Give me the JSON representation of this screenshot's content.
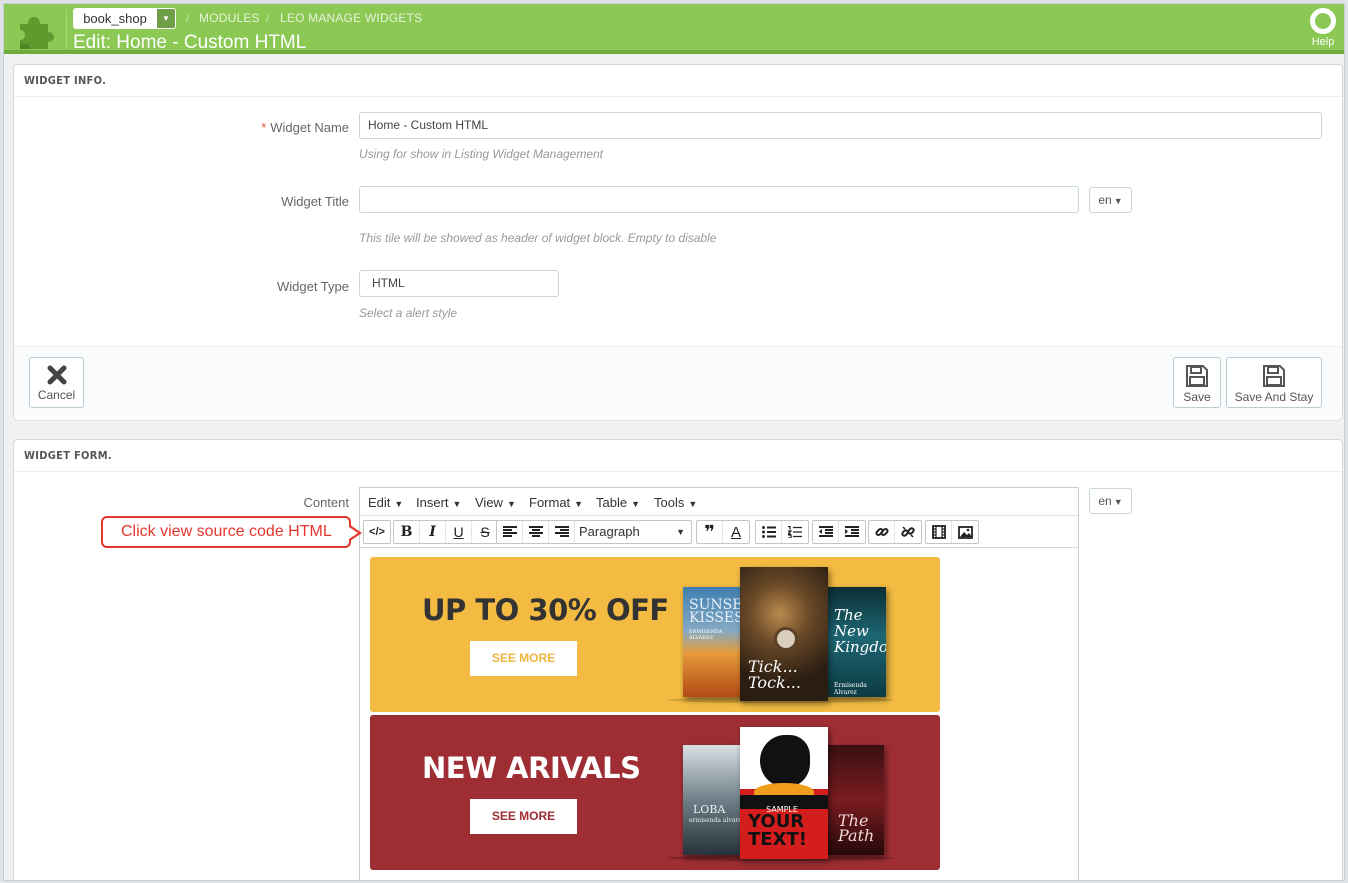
{
  "header": {
    "shop": "book_shop",
    "breadcrumb": [
      "MODULES",
      "LEO MANAGE WIDGETS"
    ],
    "title": "Edit: Home - Custom HTML",
    "help_label": "Help"
  },
  "widget_info": {
    "heading": "WIDGET INFO.",
    "name_label": "Widget Name",
    "name_value": "Home - Custom HTML",
    "name_hint": "Using for show in Listing Widget Management",
    "title_label": "Widget Title",
    "title_value": "",
    "title_lang": "en",
    "title_hint": "This tile will be showed as header of widget block. Empty to disable",
    "type_label": "Widget Type",
    "type_value": "HTML",
    "type_hint": "Select a alert style",
    "cancel_label": "Cancel",
    "save_label": "Save",
    "save_stay_label": "Save And Stay"
  },
  "widget_form": {
    "heading": "WIDGET FORM.",
    "content_label": "Content",
    "lang": "en",
    "menu": [
      "Edit",
      "Insert",
      "View",
      "Format",
      "Table",
      "Tools"
    ],
    "format_select": "Paragraph",
    "banners": [
      {
        "title": "UP TO 30% OFF",
        "button": "SEE MORE",
        "bg": "#f3bb42",
        "btn_color": "#f0b640"
      },
      {
        "title": "NEW ARIVALS",
        "button": "SEE MORE",
        "bg": "#9e2e33",
        "btn_color": "#9e2e33"
      }
    ],
    "books": {
      "b1": [
        "SUNSET",
        "KISSES",
        "ERMISENDA ALVAREZ"
      ],
      "b2": [
        "Tick...",
        "Tock..."
      ],
      "b3": [
        "The New",
        "Kingdom",
        "Ermisenda Alvarez"
      ],
      "b4": [
        "LOBA",
        "ermisenda alvarez"
      ],
      "b5": [
        "YOUR",
        "TEXT!",
        "SAMPLE"
      ],
      "b6": [
        "The",
        "Path"
      ]
    }
  },
  "annotation": {
    "callout": "Click view source code HTML"
  },
  "colors": {
    "header_green": "#8bc954",
    "required": "#e74c3c",
    "annotation_red": "#e5372d"
  }
}
